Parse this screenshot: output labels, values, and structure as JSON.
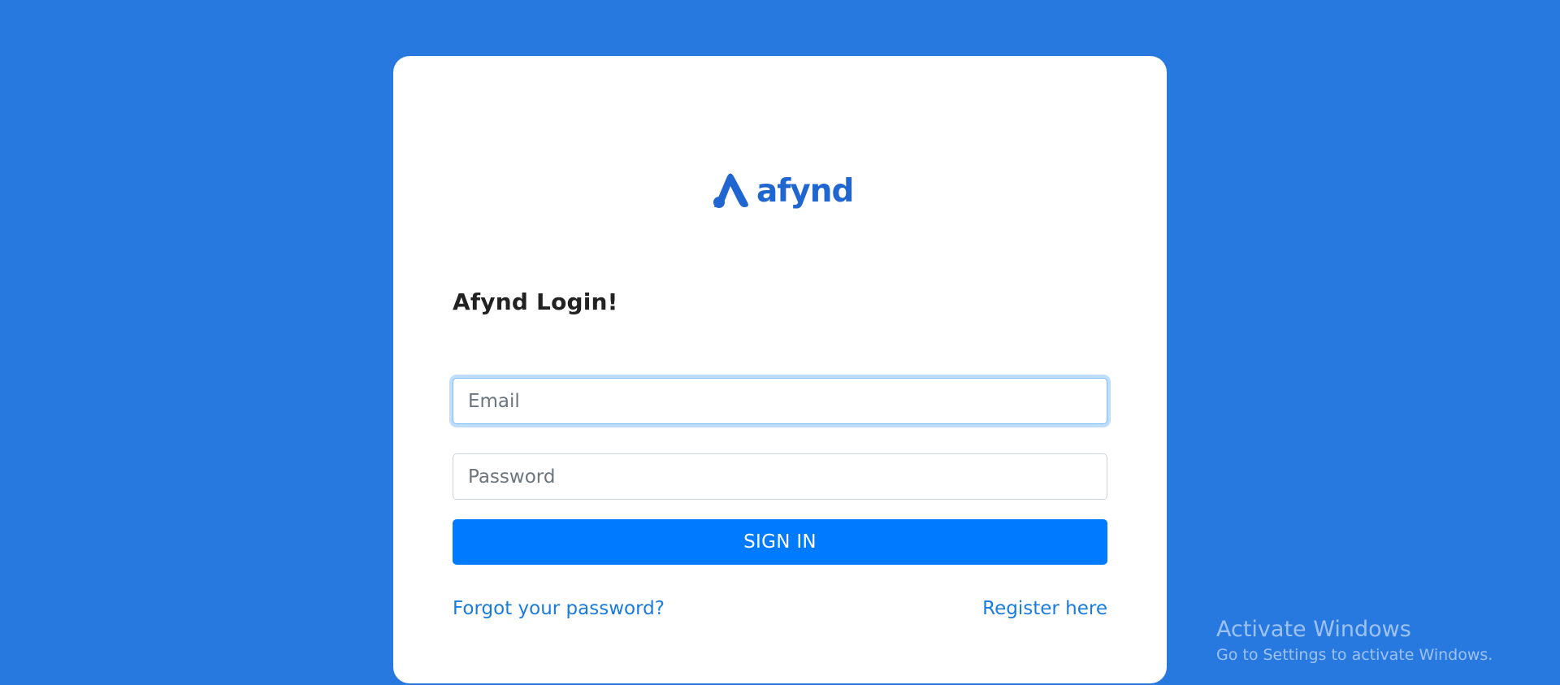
{
  "brand": {
    "name": "afynd",
    "icon": "afynd-logo-icon",
    "color": "#1f66d1"
  },
  "login": {
    "title": "Afynd Login!",
    "email_placeholder": "Email",
    "email_value": "",
    "password_placeholder": "Password",
    "password_value": "",
    "signin_label": "SIGN IN",
    "forgot_label": "Forgot your password?",
    "register_label": "Register here"
  },
  "colors": {
    "background": "#2779e0",
    "button": "#007bff",
    "link": "#1a7bdf"
  },
  "watermark": {
    "title": "Activate Windows",
    "subtitle": "Go to Settings to activate Windows."
  }
}
